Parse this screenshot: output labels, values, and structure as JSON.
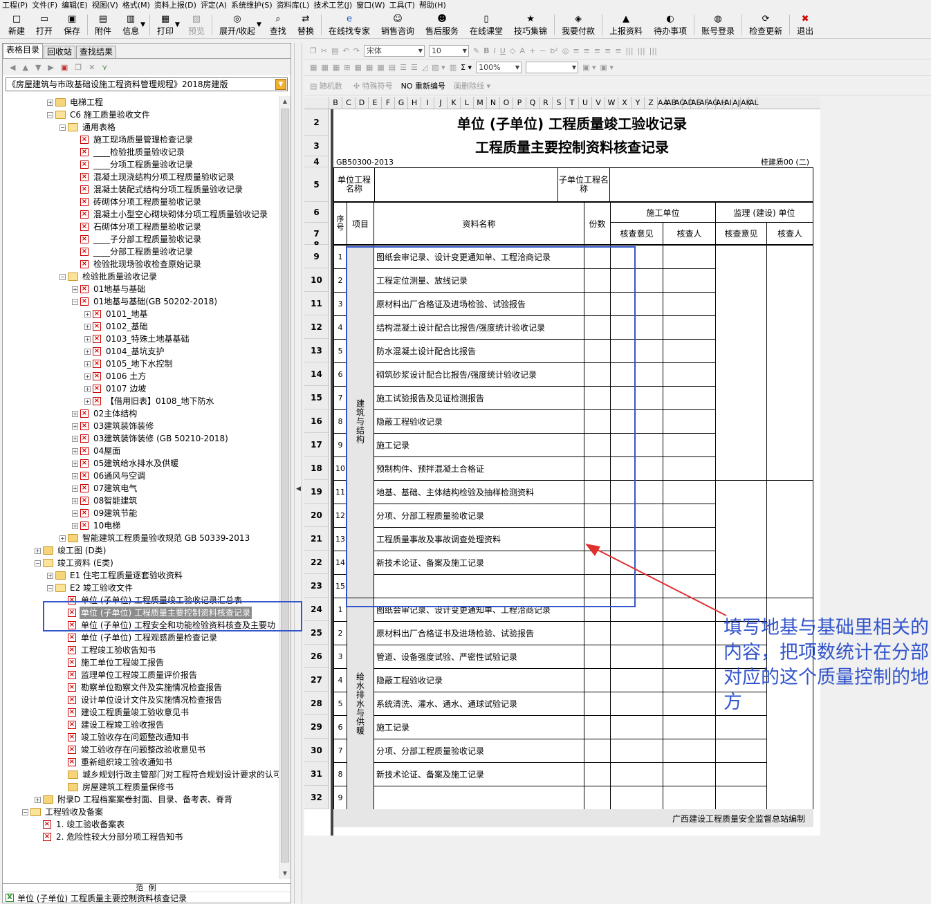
{
  "menu": [
    "工程(P)",
    "文件(F)",
    "编辑(E)",
    "视图(V)",
    "格式(M)",
    "资料上报(D)",
    "评定(A)",
    "系统维护(S)",
    "资料库(L)",
    "技术工艺(J)",
    "窗口(W)",
    "工具(T)",
    "帮助(H)"
  ],
  "toolbar": {
    "buttons": [
      {
        "label": "新建",
        "icon": "new-file-icon",
        "glyph": "□"
      },
      {
        "label": "打开",
        "icon": "open-folder-icon",
        "glyph": "▭"
      },
      {
        "label": "保存",
        "icon": "save-disk-icon",
        "glyph": "▣"
      },
      {
        "label": "附件",
        "icon": "attachment-icon",
        "glyph": "▤"
      },
      {
        "label": "信息",
        "icon": "info-icon",
        "glyph": "▥"
      },
      {
        "label": "打印",
        "icon": "print-icon",
        "glyph": "▦"
      },
      {
        "label": "预览",
        "icon": "preview-icon",
        "glyph": "▧"
      },
      {
        "label": "展开/收起",
        "icon": "expand-collapse-icon",
        "glyph": "◎"
      },
      {
        "label": "查找",
        "icon": "find-icon",
        "glyph": "⌕"
      },
      {
        "label": "替换",
        "icon": "replace-icon",
        "glyph": "⇄"
      },
      {
        "label": "在线找专家",
        "icon": "expert-icon",
        "glyph": "e"
      },
      {
        "label": "销售咨询",
        "icon": "sales-icon",
        "glyph": "☺"
      },
      {
        "label": "售后服务",
        "icon": "service-icon",
        "glyph": "☻"
      },
      {
        "label": "在线课堂",
        "icon": "classroom-icon",
        "glyph": "▯"
      },
      {
        "label": "技巧集锦",
        "icon": "tips-icon",
        "glyph": "★"
      },
      {
        "label": "我要付款",
        "icon": "payment-icon",
        "glyph": "◈"
      },
      {
        "label": "上报资料",
        "icon": "upload-icon",
        "glyph": "▲"
      },
      {
        "label": "待办事项",
        "icon": "todo-icon",
        "glyph": "◐"
      },
      {
        "label": "账号登录",
        "icon": "login-icon",
        "glyph": "◍"
      },
      {
        "label": "检查更新",
        "icon": "update-icon",
        "glyph": "⟳"
      },
      {
        "label": "退出",
        "icon": "exit-icon",
        "glyph": "✖"
      }
    ]
  },
  "left_panel": {
    "tabs": [
      "表格目录",
      "回收站",
      "查找结果"
    ],
    "spec_select": "《房屋建筑与市政基础设施工程资料管理规程》2018房建版",
    "tree": [
      {
        "indent": 3,
        "pm": "+",
        "type": "folder",
        "label": "电梯工程"
      },
      {
        "indent": 3,
        "pm": "-",
        "type": "folder-open",
        "label": "C6 施工质量验收文件"
      },
      {
        "indent": 4,
        "pm": "-",
        "type": "folder-open",
        "label": "通用表格"
      },
      {
        "indent": 5,
        "pm": "",
        "type": "x",
        "label": "施工现场质量管理检查记录"
      },
      {
        "indent": 5,
        "pm": "",
        "type": "x",
        "label": "____检验批质量验收记录"
      },
      {
        "indent": 5,
        "pm": "",
        "type": "x",
        "label": "____分项工程质量验收记录"
      },
      {
        "indent": 5,
        "pm": "",
        "type": "x",
        "label": "混凝土现浇结构分项工程质量验收记录"
      },
      {
        "indent": 5,
        "pm": "",
        "type": "x",
        "label": "混凝土装配式结构分项工程质量验收记录"
      },
      {
        "indent": 5,
        "pm": "",
        "type": "x",
        "label": "砖砌体分项工程质量验收记录"
      },
      {
        "indent": 5,
        "pm": "",
        "type": "x",
        "label": "混凝土小型空心砌块砌体分项工程质量验收记录"
      },
      {
        "indent": 5,
        "pm": "",
        "type": "x",
        "label": "石砌体分项工程质量验收记录"
      },
      {
        "indent": 5,
        "pm": "",
        "type": "x",
        "label": "____子分部工程质量验收记录"
      },
      {
        "indent": 5,
        "pm": "",
        "type": "x",
        "label": "____分部工程质量验收记录"
      },
      {
        "indent": 5,
        "pm": "",
        "type": "x",
        "label": "检验批现场验收检查原始记录"
      },
      {
        "indent": 4,
        "pm": "-",
        "type": "folder-open",
        "label": "检验批质量验收记录"
      },
      {
        "indent": 5,
        "pm": "+",
        "type": "x",
        "label": "01地基与基础"
      },
      {
        "indent": 5,
        "pm": "-",
        "type": "x",
        "label": "01地基与基础(GB 50202-2018)"
      },
      {
        "indent": 6,
        "pm": "+",
        "type": "x",
        "label": "0101_地基"
      },
      {
        "indent": 6,
        "pm": "+",
        "type": "x",
        "label": "0102_基础"
      },
      {
        "indent": 6,
        "pm": "+",
        "type": "x",
        "label": "0103_特殊土地基基础"
      },
      {
        "indent": 6,
        "pm": "+",
        "type": "x",
        "label": "0104_基坑支护"
      },
      {
        "indent": 6,
        "pm": "+",
        "type": "x",
        "label": "0105_地下水控制"
      },
      {
        "indent": 6,
        "pm": "+",
        "type": "x",
        "label": "0106 土方"
      },
      {
        "indent": 6,
        "pm": "+",
        "type": "x",
        "label": "0107 边坡"
      },
      {
        "indent": 6,
        "pm": "+",
        "type": "x",
        "label": "【借用旧表】0108_地下防水"
      },
      {
        "indent": 5,
        "pm": "+",
        "type": "x",
        "label": "02主体结构"
      },
      {
        "indent": 5,
        "pm": "+",
        "type": "x",
        "label": "03建筑装饰装修"
      },
      {
        "indent": 5,
        "pm": "+",
        "type": "x",
        "label": "03建筑装饰装修 (GB 50210-2018)"
      },
      {
        "indent": 5,
        "pm": "+",
        "type": "x",
        "label": "04屋面"
      },
      {
        "indent": 5,
        "pm": "+",
        "type": "x",
        "label": "05建筑给水排水及供暖"
      },
      {
        "indent": 5,
        "pm": "+",
        "type": "x",
        "label": "06通风与空调"
      },
      {
        "indent": 5,
        "pm": "+",
        "type": "x",
        "label": "07建筑电气"
      },
      {
        "indent": 5,
        "pm": "+",
        "type": "x",
        "label": "08智能建筑"
      },
      {
        "indent": 5,
        "pm": "+",
        "type": "x",
        "label": "09建筑节能"
      },
      {
        "indent": 5,
        "pm": "+",
        "type": "x",
        "label": "10电梯"
      },
      {
        "indent": 4,
        "pm": "+",
        "type": "folder",
        "label": "智能建筑工程质量验收规范 GB 50339-2013"
      },
      {
        "indent": 2,
        "pm": "+",
        "type": "folder",
        "label": "竣工图 (D类)"
      },
      {
        "indent": 2,
        "pm": "-",
        "type": "folder-open",
        "label": "竣工资料 (E类)"
      },
      {
        "indent": 3,
        "pm": "+",
        "type": "folder",
        "label": "E1 住宅工程质量逐套验收资料"
      },
      {
        "indent": 3,
        "pm": "-",
        "type": "folder-open",
        "label": "E2 竣工验收文件"
      },
      {
        "indent": 4,
        "pm": "",
        "type": "x",
        "label": "单位 (子单位) 工程质量竣工验收记录汇总表"
      },
      {
        "indent": 4,
        "pm": "",
        "type": "x",
        "label": "单位 (子单位) 工程质量主要控制资料核查记录",
        "selected": true
      },
      {
        "indent": 4,
        "pm": "",
        "type": "x",
        "label": "单位 (子单位) 工程安全和功能检验资料核查及主要功"
      },
      {
        "indent": 4,
        "pm": "",
        "type": "x",
        "label": "单位 (子单位) 工程观感质量检查记录"
      },
      {
        "indent": 4,
        "pm": "",
        "type": "x",
        "label": "工程竣工验收告知书"
      },
      {
        "indent": 4,
        "pm": "",
        "type": "x",
        "label": "施工单位工程竣工报告"
      },
      {
        "indent": 4,
        "pm": "",
        "type": "x",
        "label": "监理单位工程竣工质量评价报告"
      },
      {
        "indent": 4,
        "pm": "",
        "type": "x",
        "label": "勘察单位勘察文件及实施情况检查报告"
      },
      {
        "indent": 4,
        "pm": "",
        "type": "x",
        "label": "设计单位设计文件及实施情况检查报告"
      },
      {
        "indent": 4,
        "pm": "",
        "type": "x",
        "label": "建设工程质量竣工验收意见书"
      },
      {
        "indent": 4,
        "pm": "",
        "type": "x",
        "label": "建设工程竣工验收报告"
      },
      {
        "indent": 4,
        "pm": "",
        "type": "x",
        "label": "竣工验收存在问题整改通知书"
      },
      {
        "indent": 4,
        "pm": "",
        "type": "x",
        "label": "竣工验收存在问题整改验收意见书"
      },
      {
        "indent": 4,
        "pm": "",
        "type": "x",
        "label": "重新组织竣工验收通知书"
      },
      {
        "indent": 4,
        "pm": "",
        "type": "folder",
        "label": "城乡规划行政主管部门对工程符合规划设计要求的认可文"
      },
      {
        "indent": 4,
        "pm": "",
        "type": "folder",
        "label": "房屋建筑工程质量保修书"
      },
      {
        "indent": 2,
        "pm": "+",
        "type": "folder",
        "label": "附录D 工程档案案卷封面、目录、备考表、脊背"
      },
      {
        "indent": 1,
        "pm": "-",
        "type": "folder-open",
        "label": "工程验收及备案"
      },
      {
        "indent": 2,
        "pm": "",
        "type": "x",
        "label": "1. 竣工验收备案表"
      },
      {
        "indent": 2,
        "pm": "",
        "type": "x",
        "label": "2. 危险性较大分部分项工程告知书"
      }
    ],
    "example_header": "范  例",
    "example_item": "单位 (子单位) 工程质量主要控制资料核查记录"
  },
  "format_toolbar": {
    "font": "宋体",
    "size": "10",
    "zoom": "100%",
    "row3": [
      "随机数",
      "特殊符号",
      "NO 重新编号",
      "画删除线"
    ]
  },
  "columns": [
    "B",
    "C",
    "D",
    "E",
    "F",
    "G",
    "H",
    "I",
    "J",
    "K",
    "L",
    "M",
    "N",
    "O",
    "P",
    "Q",
    "R",
    "S",
    "T",
    "U",
    "V",
    "W",
    "X",
    "Y",
    "Z",
    "AA",
    "AB",
    "AC",
    "AD",
    "AE",
    "AF",
    "AG",
    "AH",
    "AI",
    "AJ",
    "AK",
    "AL"
  ],
  "form": {
    "title1": "单位 (子单位) 工程质量竣工验收记录",
    "title2": "工程质量主要控制资料核查记录",
    "standard": "GB50300-2013",
    "form_no": "桂建质00 (二)",
    "unit_name_label": "单位工程名称",
    "subunit_name_label": "子单位工程名称",
    "headers": {
      "seq": "序号",
      "item": "项目",
      "doc_name": "资料名称",
      "copies": "份数",
      "construction_unit": "施工单位",
      "supervision_unit": "监理 (建设) 单位",
      "check_opinion": "核查意见",
      "checker": "核查人"
    },
    "group1_label": "建筑与结构",
    "group1": [
      {
        "no": "1",
        "name": "图纸会审记录、设计变更通知单、工程洽商记录"
      },
      {
        "no": "2",
        "name": "工程定位测量、放线记录"
      },
      {
        "no": "3",
        "name": "原材料出厂合格证及进场检验、试验报告"
      },
      {
        "no": "4",
        "name": "结构混凝土设计配合比报告/强度统计验收记录"
      },
      {
        "no": "5",
        "name": "防水混凝土设计配合比报告"
      },
      {
        "no": "6",
        "name": "砌筑砂浆设计配合比报告/强度统计验收记录"
      },
      {
        "no": "7",
        "name": "施工试验报告及见证检测报告"
      },
      {
        "no": "8",
        "name": "隐蔽工程验收记录"
      },
      {
        "no": "9",
        "name": "施工记录"
      },
      {
        "no": "10",
        "name": "预制构件、预拌混凝土合格证"
      },
      {
        "no": "11",
        "name": "地基、基础、主体结构检验及抽样检测资料"
      },
      {
        "no": "12",
        "name": "分项、分部工程质量验收记录"
      },
      {
        "no": "13",
        "name": "工程质量事故及事故调查处理资料"
      },
      {
        "no": "14",
        "name": "新技术论证、备案及施工记录"
      },
      {
        "no": "15",
        "name": ""
      }
    ],
    "group2_label": "给水排水与供暖",
    "group2": [
      {
        "no": "1",
        "name": "图纸会审记录、设计变更通知单、工程洽商记录"
      },
      {
        "no": "2",
        "name": "原材料出厂合格证书及进场检验、试验报告"
      },
      {
        "no": "3",
        "name": "管道、设备强度试验、严密性试验记录"
      },
      {
        "no": "4",
        "name": "隐蔽工程验收记录"
      },
      {
        "no": "5",
        "name": "系统清洗、灌水、通水、通球试验记录"
      },
      {
        "no": "6",
        "name": "施工记录"
      },
      {
        "no": "7",
        "name": "分项、分部工程质量验收记录"
      },
      {
        "no": "8",
        "name": "新技术论证、备案及施工记录"
      },
      {
        "no": "9",
        "name": ""
      }
    ],
    "footer": "广西建设工程质量安全监督总站编制",
    "row_numbers": [
      "2",
      "3",
      "4",
      "5",
      "6",
      "7",
      "8",
      "9",
      "10",
      "11",
      "12",
      "13",
      "14",
      "15",
      "16",
      "17",
      "18",
      "19",
      "20",
      "21",
      "22",
      "23",
      "24",
      "25",
      "26",
      "27",
      "28",
      "29",
      "30",
      "31",
      "32"
    ]
  },
  "annotation": {
    "text": "填写地基与基础里相关的内容，把项数统计在分部对应的这个质量控制的地方",
    "color": "#3355cc",
    "arrow_color": "#e03030"
  }
}
